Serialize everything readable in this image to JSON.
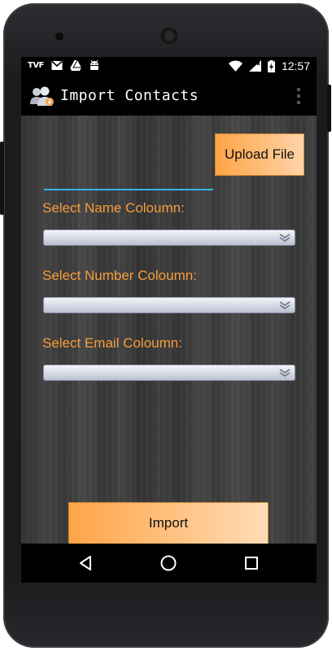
{
  "status_bar": {
    "time": "12:57",
    "left_icons": [
      "tvf-icon",
      "gmail-icon",
      "drive-icon",
      "android-icon"
    ],
    "right_icons": [
      "wifi-icon",
      "signal-icon",
      "battery-charging-icon"
    ]
  },
  "action_bar": {
    "title": "Import Contacts",
    "icon": "contacts-icon"
  },
  "form": {
    "file_value": "",
    "upload_label": "Upload File",
    "name_label": "Select Name Coloumn:",
    "number_label": "Select Number Coloumn:",
    "email_label": "Select Email Coloumn:",
    "name_value": "",
    "number_value": "",
    "email_value": "",
    "import_label": "Import"
  },
  "colors": {
    "accent_orange": "#f79d3a",
    "button_orange": "#ffa447",
    "holo_blue": "#33b5e5"
  },
  "nav_bar": {
    "icons": [
      "back-icon",
      "home-icon",
      "recents-icon"
    ]
  }
}
